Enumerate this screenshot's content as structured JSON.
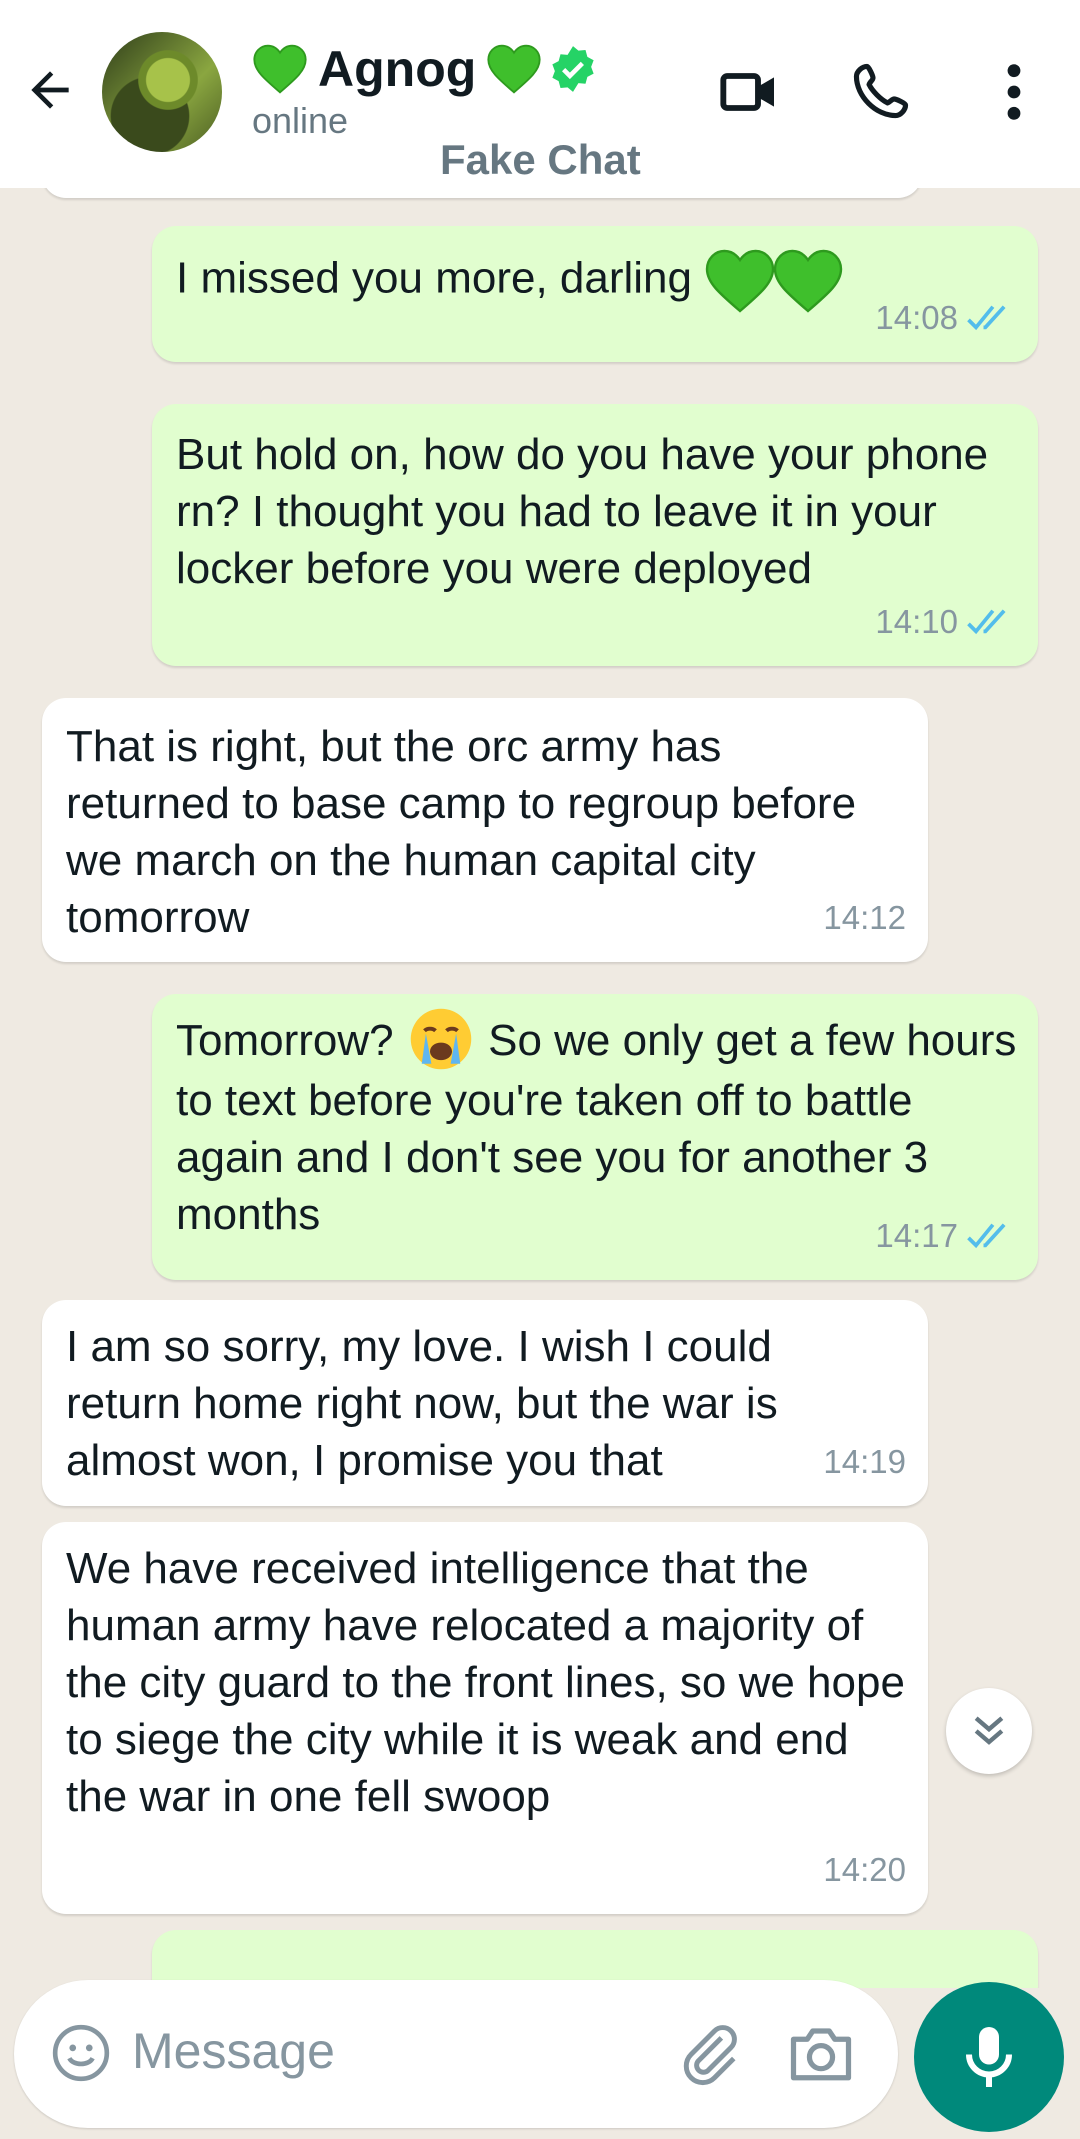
{
  "header": {
    "name": "Agnog",
    "status": "online",
    "watermark": "Fake Chat"
  },
  "colors": {
    "outgoing_bubble": "#e1fecf",
    "incoming_bubble": "#ffffff",
    "read_ticks": "#53bdeb",
    "mic_button": "#00897b",
    "verified_badge": "#25d366"
  },
  "icons": {
    "back": "arrow-left-icon",
    "video": "video-camera-icon",
    "call": "phone-icon",
    "menu": "more-vertical-icon",
    "scroll": "double-chevron-down-icon",
    "emoji": "smiley-icon",
    "attach": "paperclip-icon",
    "camera": "camera-icon",
    "mic": "microphone-icon"
  },
  "messages": [
    {
      "direction": "out",
      "text": "I missed you more, darling",
      "time": "14:08",
      "status": "read"
    },
    {
      "direction": "out",
      "text": "But hold on, how do you have your phone rn? I thought you had to leave it in your locker before you were deployed",
      "time": "14:10",
      "status": "read"
    },
    {
      "direction": "in",
      "text": "That is right, but the orc army has returned to base camp to regroup before we march on the human capital city tomorrow",
      "time": "14:12"
    },
    {
      "direction": "out",
      "text_before": "Tomorrow?",
      "text_after": "So we only get a few hours to text before you're taken off to battle again and I don't see you for another 3 months",
      "time": "14:17",
      "status": "read"
    },
    {
      "direction": "in",
      "text": "I am so sorry, my love. I wish I could return home right now, but the war is almost won, I promise you that",
      "time": "14:19"
    },
    {
      "direction": "in",
      "text": "We have received intelligence that the human army have relocated a majority of the city guard to the front lines, so we hope to siege the city while it is weak and end the war in one fell swoop",
      "time": "14:20"
    }
  ],
  "composer": {
    "placeholder": "Message"
  }
}
